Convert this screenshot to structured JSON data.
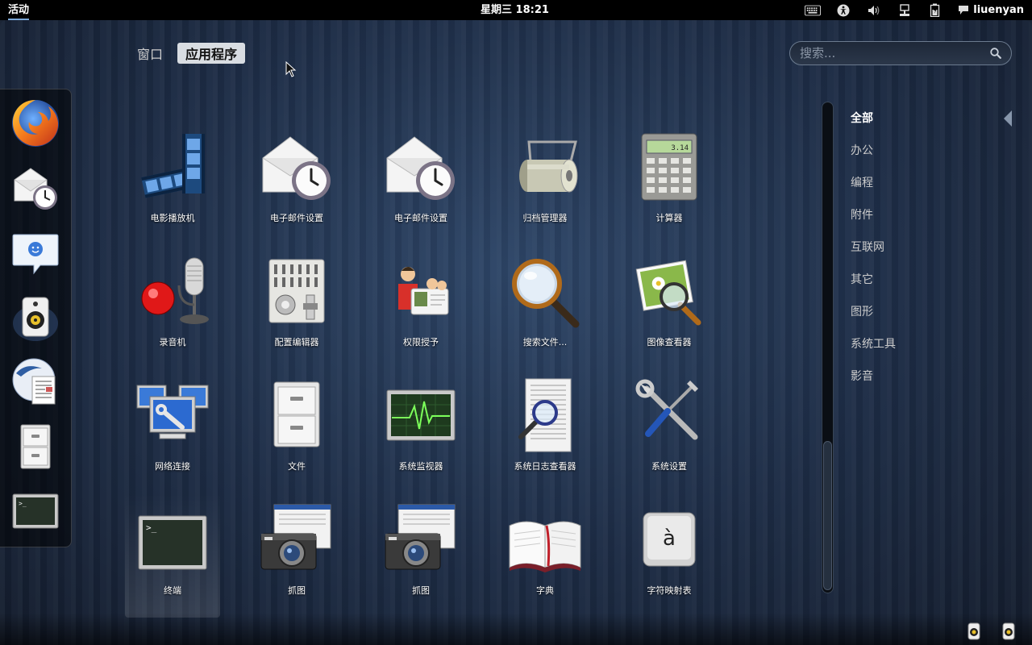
{
  "topbar": {
    "activities": "活动",
    "clock": "星期三  18:21",
    "username": "liuenyan"
  },
  "view_tabs": [
    {
      "label": "窗口",
      "active": false
    },
    {
      "label": "应用程序",
      "active": true
    }
  ],
  "search": {
    "placeholder": "搜索..."
  },
  "dash": [
    {
      "icon": "firefox-icon"
    },
    {
      "icon": "mail-settings-icon"
    },
    {
      "icon": "chat-icon"
    },
    {
      "icon": "rhythmbox-speaker-icon"
    },
    {
      "icon": "office-writer-icon"
    },
    {
      "icon": "file-cabinet-icon"
    },
    {
      "icon": "terminal-icon"
    }
  ],
  "apps": [
    {
      "label": "电影播放机",
      "icon": "film-icon"
    },
    {
      "label": "电子邮件设置",
      "icon": "mail-clock-icon"
    },
    {
      "label": "电子邮件设置",
      "icon": "mail-clock-icon"
    },
    {
      "label": "归档管理器",
      "icon": "archive-roller-icon"
    },
    {
      "label": "计算器",
      "icon": "calculator-icon"
    },
    {
      "label": "录音机",
      "icon": "microphone-icon"
    },
    {
      "label": "配置编辑器",
      "icon": "config-panel-icon"
    },
    {
      "label": "权限授予",
      "icon": "policykit-icon"
    },
    {
      "label": "搜索文件...",
      "icon": "magnifier-icon"
    },
    {
      "label": "图像查看器",
      "icon": "image-viewer-icon"
    },
    {
      "label": "网络连接",
      "icon": "network-icon"
    },
    {
      "label": "文件",
      "icon": "file-cabinet-icon"
    },
    {
      "label": "系统监视器",
      "icon": "system-monitor-icon"
    },
    {
      "label": "系统日志查看器",
      "icon": "log-viewer-icon"
    },
    {
      "label": "系统设置",
      "icon": "tools-icon"
    },
    {
      "label": "终端",
      "icon": "terminal-icon"
    },
    {
      "label": "抓图",
      "icon": "camera-icon"
    },
    {
      "label": "抓图",
      "icon": "camera-icon"
    },
    {
      "label": "字典",
      "icon": "book-icon"
    },
    {
      "label": "字符映射表",
      "icon": "charmap-key-icon"
    }
  ],
  "categories": [
    {
      "label": "全部",
      "active": true
    },
    {
      "label": "办公"
    },
    {
      "label": "编程"
    },
    {
      "label": "附件"
    },
    {
      "label": "互联网"
    },
    {
      "label": "其它"
    },
    {
      "label": "图形"
    },
    {
      "label": "系统工具"
    },
    {
      "label": "影音"
    }
  ],
  "charmap_glyph": "à",
  "colors": {
    "topbar": "#000000",
    "accent": "#7aa7d8",
    "background": "#1d2c45"
  }
}
